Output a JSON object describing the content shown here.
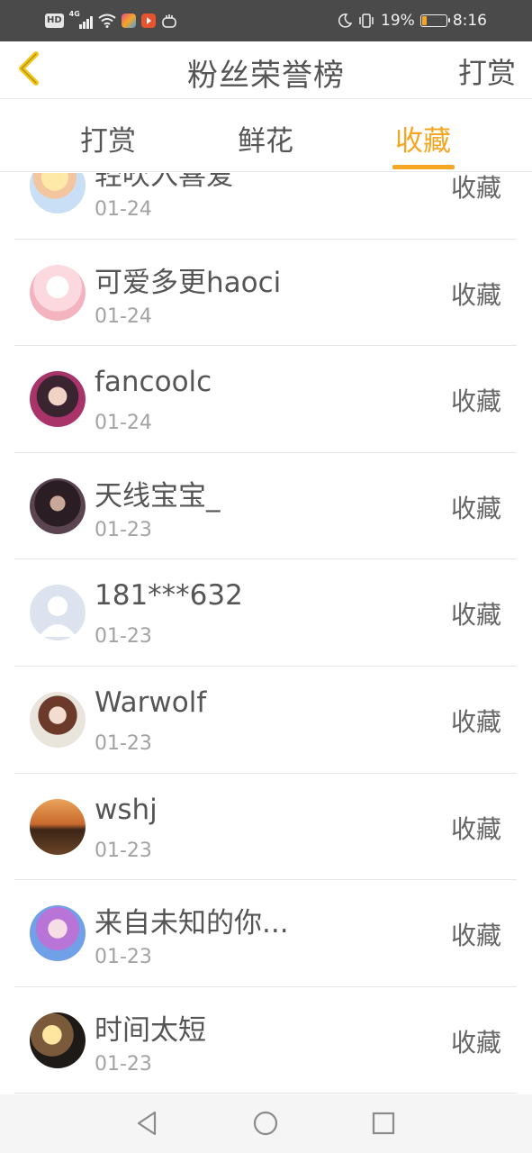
{
  "status_bar": {
    "left_icons": [
      "hd-icon",
      "4g-signal-icon",
      "wifi-icon",
      "app-icon",
      "video-app-icon",
      "grab-icon"
    ],
    "hd_label": "HD",
    "network_label": "4G",
    "right_icons": [
      "moon-icon",
      "vibrate-icon"
    ],
    "battery_percent": "19%",
    "battery_level": 0.19,
    "time": "8:16"
  },
  "header": {
    "title": "粉丝荣誉榜",
    "action_label": "打赏",
    "back_icon": "back-chevron-icon",
    "accent_color": "#f5a623"
  },
  "tabs": [
    {
      "label": "打赏",
      "active": false
    },
    {
      "label": "鲜花",
      "active": false
    },
    {
      "label": "收藏",
      "active": true
    }
  ],
  "fans": [
    {
      "name": "轻吹入喜爱",
      "date": "01-24",
      "action": "收藏"
    },
    {
      "name": "可爱多更haoci",
      "date": "01-24",
      "action": "收藏"
    },
    {
      "name": "fancoolc",
      "date": "01-24",
      "action": "收藏"
    },
    {
      "name": "天线宝宝_",
      "date": "01-23",
      "action": "收藏"
    },
    {
      "name": "181***632",
      "date": "01-23",
      "action": "收藏"
    },
    {
      "name": "Warwolf",
      "date": "01-23",
      "action": "收藏"
    },
    {
      "name": "wshj",
      "date": "01-23",
      "action": "收藏"
    },
    {
      "name": "来自未知的你...",
      "date": "01-23",
      "action": "收藏"
    },
    {
      "name": "时间太短",
      "date": "01-23",
      "action": "收藏"
    }
  ],
  "nav_bar": {
    "buttons": [
      "back-triangle-icon",
      "home-circle-icon",
      "recents-square-icon"
    ]
  }
}
